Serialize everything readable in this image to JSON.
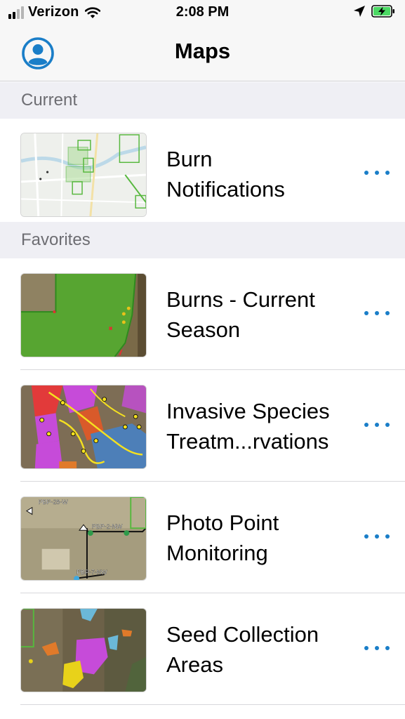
{
  "status_bar": {
    "carrier": "Verizon",
    "time": "2:08 PM",
    "signal_bars_filled": 2,
    "signal_bars_total": 4
  },
  "nav": {
    "title": "Maps",
    "profile_icon": "person-circle-icon"
  },
  "sections": {
    "current": "Current",
    "favorites": "Favorites"
  },
  "items": [
    {
      "title": "Burn\nNotifications",
      "thumb": "street-map"
    },
    {
      "title": "Burns - Current\nSeason",
      "thumb": "green-field"
    },
    {
      "title": "Invasive Species\nTreatm...rvations",
      "thumb": "invasive-species"
    },
    {
      "title": "Photo Point\nMonitoring",
      "thumb": "photo-points"
    },
    {
      "title": "Seed Collection\nAreas",
      "thumb": "seed-collection"
    }
  ],
  "thumb_labels": {
    "pbp_28w": "PBP-28-W",
    "pbp_2nw": "PBP-2-NW",
    "pbp_7nw": "PBP-7-NW"
  },
  "colors": {
    "accent": "#1a7ec8",
    "section_bg": "#efeff4",
    "section_text": "#6d6d72",
    "battery_green": "#4cd964"
  }
}
